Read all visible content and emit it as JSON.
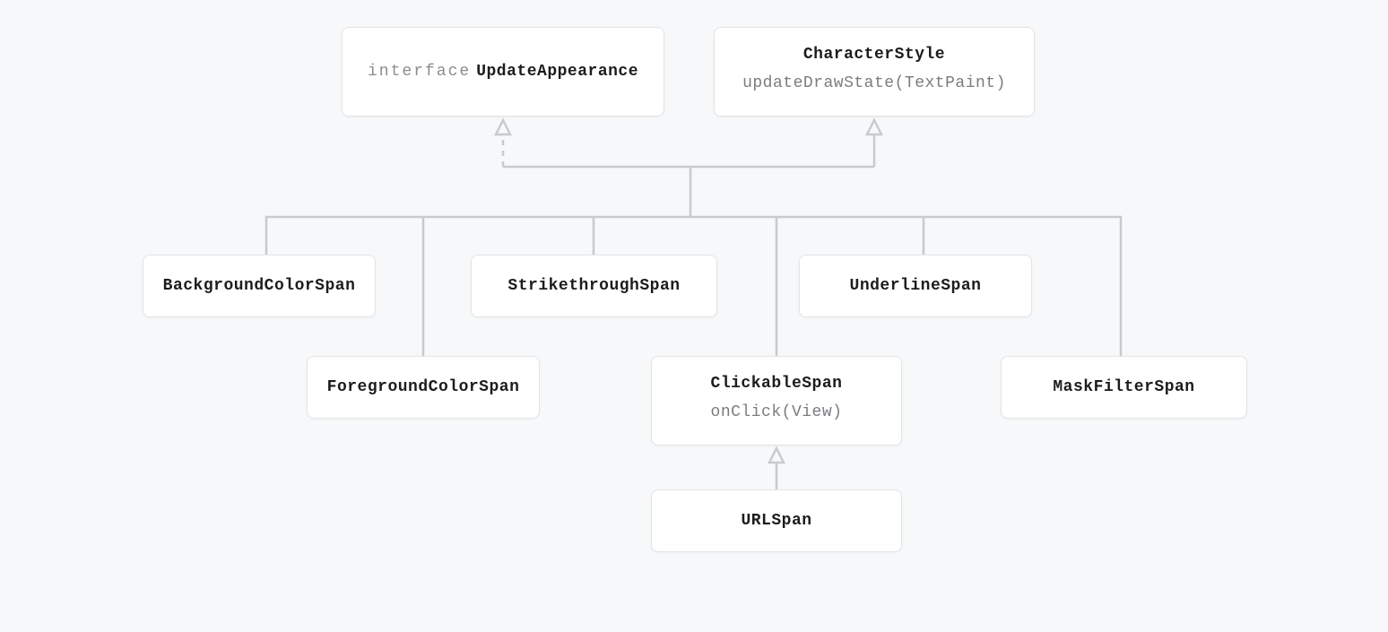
{
  "nodes": {
    "updateAppearance": {
      "keyword": "interface",
      "title": "UpdateAppearance"
    },
    "characterStyle": {
      "title": "CharacterStyle",
      "method": "updateDrawState(TextPaint)"
    },
    "backgroundColor": {
      "title": "BackgroundColorSpan"
    },
    "foregroundColor": {
      "title": "ForegroundColorSpan"
    },
    "strikethrough": {
      "title": "StrikethroughSpan"
    },
    "underline": {
      "title": "UnderlineSpan"
    },
    "maskFilter": {
      "title": "MaskFilterSpan"
    },
    "clickable": {
      "title": "ClickableSpan",
      "method": "onClick(View)"
    },
    "url": {
      "title": "URLSpan"
    }
  }
}
